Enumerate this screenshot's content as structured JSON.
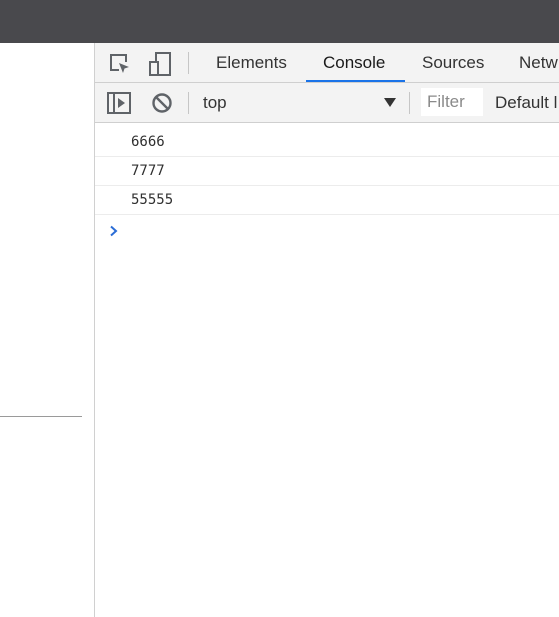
{
  "tabs": [
    {
      "label": "Elements"
    },
    {
      "label": "Console",
      "active": true
    },
    {
      "label": "Sources"
    },
    {
      "label": "Netw"
    }
  ],
  "toolbar_icons": [
    "inspect-element-icon",
    "device-toggle-icon"
  ],
  "console_toolbar": {
    "sidebar_icon": "show-sidebar-icon",
    "clear_icon": "clear-console-icon",
    "context": "top",
    "filter_placeholder": "Filter",
    "levels_label": "Default l"
  },
  "console": {
    "messages": [
      "6666",
      "7777",
      "55555"
    ],
    "prompt_icon": "chevron-right-icon"
  },
  "colors": {
    "titlebar": "#49494d",
    "accent": "#1a73e8",
    "toolbar_bg": "#f3f3f3"
  }
}
